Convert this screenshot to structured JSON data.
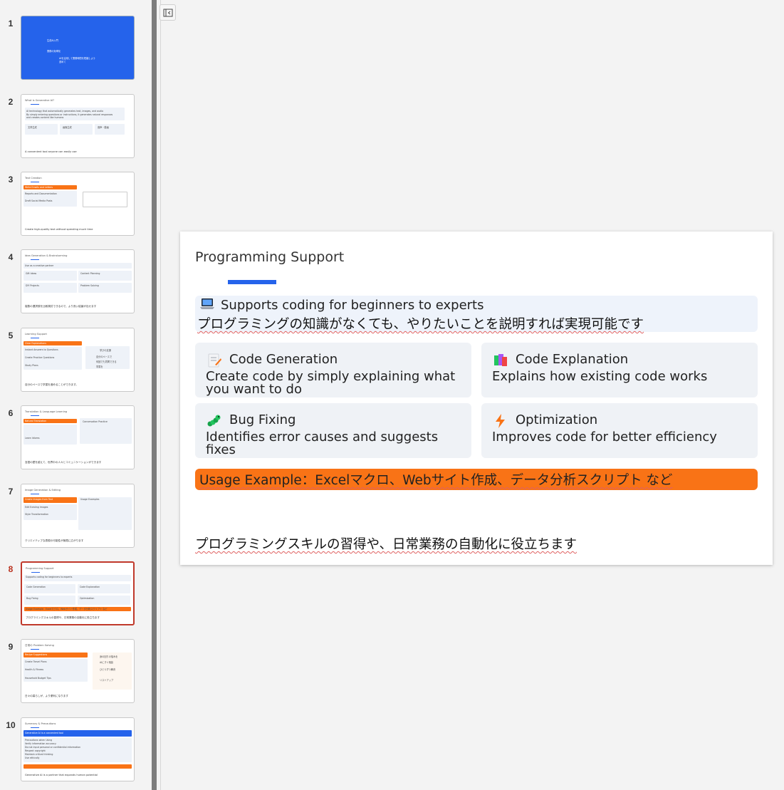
{
  "slide_numbers": [
    "1",
    "2",
    "3",
    "4",
    "5",
    "6",
    "7",
    "8",
    "9",
    "10"
  ],
  "thumbnails": {
    "s1": {
      "lines": [
        "生成AI入門",
        "業務の効率化",
        "AIを活用して業務時間を短縮しよう",
        "進めて"
      ]
    },
    "s2": {
      "title": "What is Generative AI?",
      "lines": [
        "AI technology that automatically generates text, images, and audio",
        "By simply entering questions or instructions, it generates natural responses",
        "and creates content like humans"
      ],
      "cols": [
        "文章生成",
        "画像生成",
        "音声・動画"
      ],
      "footer": "A convenient tool anyone can easily use"
    },
    "s3": {
      "title": "Text Creation",
      "items": [
        "Write Emails and Letters",
        "Reports and Documentation",
        "Draft Social Media Posts"
      ],
      "footer": "Create high-quality text without spending much time"
    },
    "s4": {
      "title": "Idea Generation & Brainstorming",
      "items": [
        "Use as a creative partner",
        "Gift Ideas",
        "Content Planning",
        "DIY Projects",
        "Problem Solving"
      ],
      "footer": "複数の選択肢を比較検討できるので、より良い結論が出せます"
    },
    "s5": {
      "title": "Learning Support",
      "items": [
        "Clear Explanations",
        "Instant Answers to Questions",
        "Create Practice Questions",
        "Study Plans"
      ],
      "side": [
        "学びの支援",
        "自分のペースで",
        "何回でも質問できる",
        "学習を"
      ],
      "footer": "自分のペースで学習を進めることができます。"
    },
    "s6": {
      "title": "Translation & Language Learning",
      "items": [
        "Natural Translation",
        "Conversation Practice",
        "Learn Idioms"
      ],
      "footer": "言語の壁を越えて、世界中の人々とコミュニケーションができます"
    },
    "s7": {
      "title": "Image Generation & Editing",
      "items": [
        "Create Images from Text",
        "Edit Existing Images",
        "Style Transformation",
        "Usage Examples"
      ],
      "footer": "クリエイティブな表現の可能性が無限に広がります"
    },
    "s8": {
      "title": "Programming Support",
      "items": [
        "Supports coding for beginners to experts",
        "Code Generation",
        "Code Explanation",
        "Bug Fixing",
        "Optimization",
        "Usage Example：Excelマクロ、Webサイト作成、データ分析スクリプト など"
      ],
      "footer": "プログラミングスキルの習得や、日常業務の自動化に役立ちます"
    },
    "s9": {
      "title": "日常の Problem Solving",
      "items": [
        "Recipe Suggestions",
        "Create Travel Plans",
        "Health & Fitness",
        "Household Budget Tips"
      ],
      "side": [
        "身の回りの悩みを",
        "AIにすぐ相談",
        "ひとつずつ解決",
        "リストアップ"
      ],
      "footer": "日々の暮らしが、より便利になります"
    },
    "s10": {
      "title": "Summary & Precautions",
      "items": [
        "Generative AI is a convenient tool",
        "Precautions when Using",
        "Verify information accuracy",
        "Do not input personal or confidential information",
        "Respect copyright",
        "Maintain critical thinking",
        "Use ethically"
      ],
      "footer": "Generative AI is a partner that expands human potential"
    }
  },
  "slide": {
    "title": "Programming Support",
    "banner": {
      "icon": "laptop-icon",
      "heading": "Supports coding for beginners to experts",
      "subtext": "プログラミングの知識がなくても、やりたいことを説明すれば実現可能です"
    },
    "cards": [
      {
        "icon": "memo-icon",
        "heading": "Code Generation",
        "desc": "Create code by simply explaining what you want to do"
      },
      {
        "icon": "books-icon",
        "heading": "Code Explanation",
        "desc": "Explains how existing code works"
      },
      {
        "icon": "bug-icon",
        "heading": "Bug Fixing",
        "desc": "Identifies error causes and suggests fixes"
      },
      {
        "icon": "lightning-icon",
        "heading": "Optimization",
        "desc": "Improves code for better efficiency"
      }
    ],
    "usage": "Usage Example：Excelマクロ、Webサイト作成、データ分析スクリプト など",
    "summary": "プログラミングスキルの習得や、日常業務の自動化に役立ちます"
  },
  "colors": {
    "accent": "#2563eb",
    "highlight": "#f97316",
    "active_border": "#c0392b",
    "card_bg": "#eff2f6"
  }
}
